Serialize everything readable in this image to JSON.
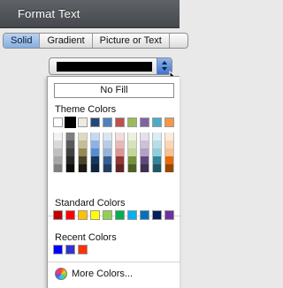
{
  "window": {
    "title": "Format Text"
  },
  "tabs": [
    {
      "label": "Solid",
      "active": true
    },
    {
      "label": "Gradient",
      "active": false
    },
    {
      "label": "Picture or Text",
      "active": false
    }
  ],
  "color_picker": {
    "current_color": "#000000",
    "no_fill_label": "No Fill",
    "theme_label": "Theme Colors",
    "theme_colors": [
      "#ffffff",
      "#000000",
      "#eeece1",
      "#1f497d",
      "#4f81bd",
      "#c0504d",
      "#9bbb59",
      "#8064a2",
      "#4bacc6",
      "#f79646"
    ],
    "theme_tints": [
      [
        "#f2f2f2",
        "#d9d9d9",
        "#bfbfbf",
        "#a6a6a6",
        "#808080"
      ],
      [
        "#7f7f7f",
        "#595959",
        "#404040",
        "#262626",
        "#0d0d0d"
      ],
      [
        "#ddd9c3",
        "#c4bd97",
        "#948a54",
        "#4a452a",
        "#1d1b10"
      ],
      [
        "#c6d9f1",
        "#8db3e2",
        "#548dd4",
        "#17365d",
        "#0f243e"
      ],
      [
        "#dbe5f1",
        "#b8cce4",
        "#95b3d7",
        "#366092",
        "#244061"
      ],
      [
        "#f2dcdb",
        "#e6b9b8",
        "#d99694",
        "#953734",
        "#632523"
      ],
      [
        "#ebf1dd",
        "#d7e3bc",
        "#c3d69b",
        "#76923c",
        "#4f6128"
      ],
      [
        "#e5e0ec",
        "#ccc1d9",
        "#b2a1c7",
        "#5f497a",
        "#3f3151"
      ],
      [
        "#dbeef3",
        "#b7dde8",
        "#92cddc",
        "#31859b",
        "#205867"
      ],
      [
        "#fdeada",
        "#fbd5b5",
        "#fac08f",
        "#e36c09",
        "#974806"
      ]
    ],
    "standard_label": "Standard Colors",
    "standard_colors": [
      "#c00000",
      "#ff0000",
      "#ffc000",
      "#ffff00",
      "#92d050",
      "#00b050",
      "#00b0f0",
      "#0070c0",
      "#002060",
      "#7030a0"
    ],
    "recent_label": "Recent Colors",
    "recent_colors": [
      "#0000ff",
      "#3333cc",
      "#ff3300"
    ],
    "more_colors_label": "More Colors..."
  }
}
